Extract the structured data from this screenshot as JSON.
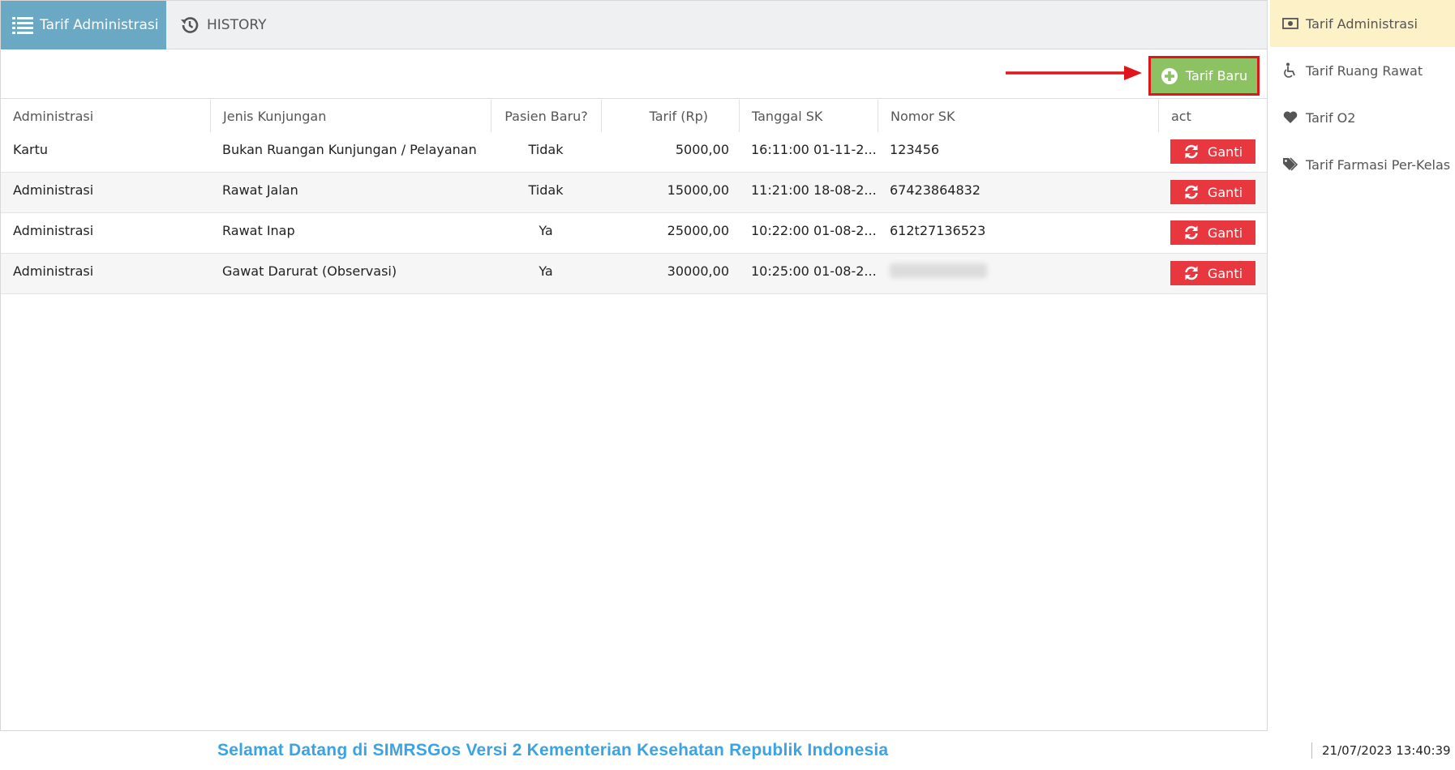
{
  "tabs": [
    {
      "label": "Tarif Administrasi",
      "icon": "list-icon"
    },
    {
      "label": "HISTORY",
      "icon": "history-icon"
    }
  ],
  "toolbar": {
    "new_button_label": "Tarif Baru"
  },
  "table": {
    "headers": [
      "Administrasi",
      "Jenis Kunjungan",
      "Pasien Baru?",
      "Tarif (Rp)",
      "Tanggal SK",
      "Nomor SK",
      "act"
    ],
    "rows": [
      {
        "administrasi": "Kartu",
        "jenis": "Bukan Ruangan Kunjungan / Pelayanan",
        "pasien_baru": "Tidak",
        "tarif": "5000,00",
        "tanggal": "16:11:00 01-11-2...",
        "nomor": "123456",
        "action": "Ganti"
      },
      {
        "administrasi": "Administrasi",
        "jenis": "Rawat Jalan",
        "pasien_baru": "Tidak",
        "tarif": "15000,00",
        "tanggal": "11:21:00 18-08-2...",
        "nomor": "67423864832",
        "action": "Ganti"
      },
      {
        "administrasi": "Administrasi",
        "jenis": "Rawat Inap",
        "pasien_baru": "Ya",
        "tarif": "25000,00",
        "tanggal": "10:22:00 01-08-2...",
        "nomor": "612t27136523",
        "action": "Ganti"
      },
      {
        "administrasi": "Administrasi",
        "jenis": "Gawat Darurat (Observasi)",
        "pasien_baru": "Ya",
        "tarif": "30000,00",
        "tanggal": "10:25:00 01-08-2...",
        "nomor": "",
        "action": "Ganti"
      }
    ]
  },
  "sidebar": {
    "items": [
      {
        "label": "Tarif Administrasi",
        "icon": "money-icon",
        "active": true
      },
      {
        "label": "Tarif Ruang Rawat",
        "icon": "wheelchair-icon",
        "active": false
      },
      {
        "label": "Tarif O2",
        "icon": "heart-icon",
        "active": false
      },
      {
        "label": "Tarif Farmasi Per-Kelas",
        "icon": "tags-icon",
        "active": false
      }
    ]
  },
  "footer": {
    "welcome": "Selamat Datang di SIMRSGos Versi 2 Kementerian Kesehatan Republik Indonesia",
    "datetime": "21/07/2023 13:40:39"
  },
  "colors": {
    "tab_active": "#6ba8c4",
    "button_new": "#8dc262",
    "highlight_border": "#e0161d",
    "button_ganti": "#e8373f",
    "sidebar_active": "#fcf1c7",
    "welcome_text": "#3aa3e3"
  }
}
